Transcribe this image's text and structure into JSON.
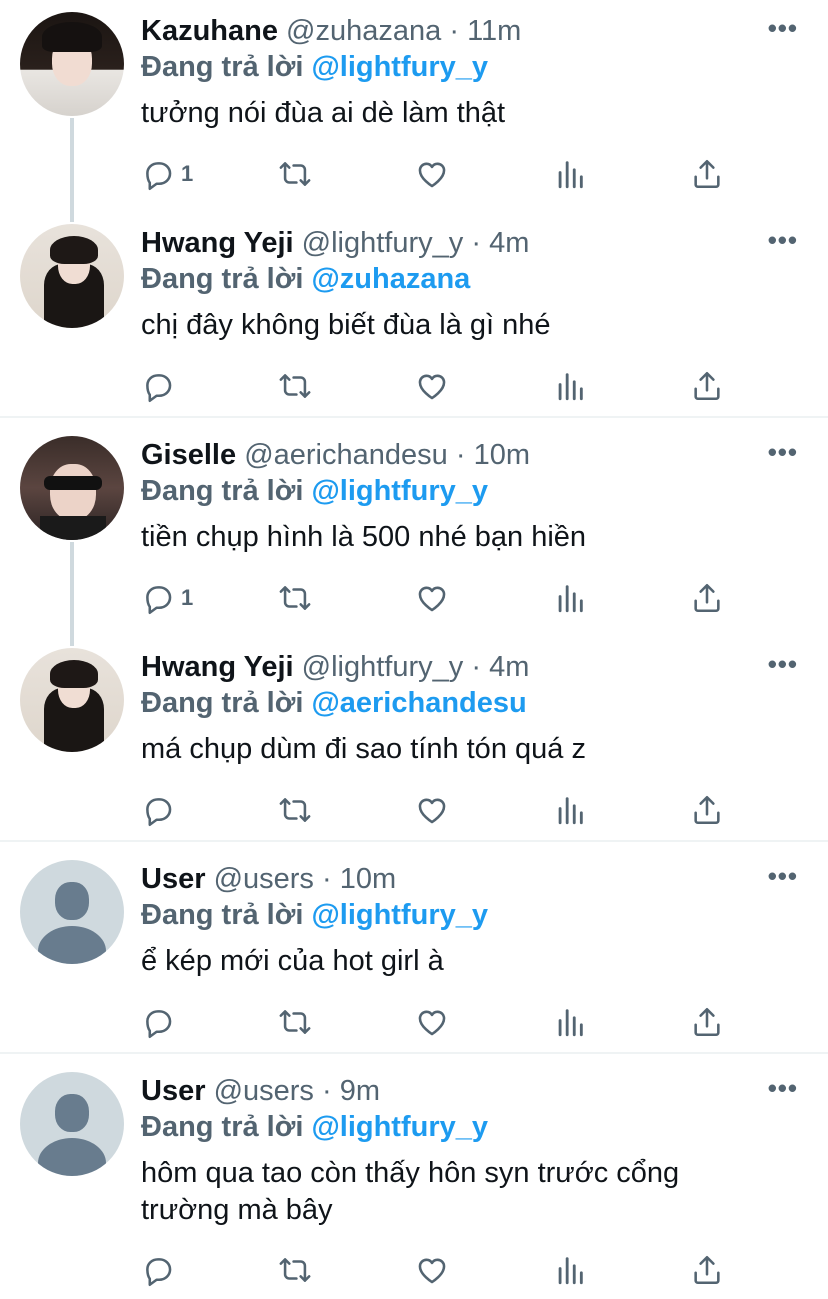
{
  "reply_prefix": "Đang trả lời",
  "more_glyph": "•••",
  "separator": "·",
  "icons": [
    "reply-icon",
    "retweet-icon",
    "like-icon",
    "analytics-icon",
    "share-icon",
    "more-icon"
  ],
  "colors": {
    "mention": "#1d9bf0",
    "muted": "#536471",
    "text": "#0f1419",
    "thread_line": "#cfd9de"
  },
  "tweets": [
    {
      "name": "Kazuhane",
      "handle": "@zuhazana",
      "time": "11m",
      "replying_to": "@lightfury_y",
      "text": "tưởng nói đùa ai dè làm thật",
      "reply_count": "1"
    },
    {
      "name": "Hwang Yeji",
      "handle": "@lightfury_y",
      "time": "4m",
      "replying_to": "@zuhazana",
      "text": "chị đây không biết đùa là gì nhé",
      "reply_count": ""
    },
    {
      "name": "Giselle",
      "handle": "@aerichandesu",
      "time": "10m",
      "replying_to": "@lightfury_y",
      "text": "tiền chụp hình là 500 nhé bạn hiền",
      "reply_count": "1"
    },
    {
      "name": "Hwang Yeji",
      "handle": "@lightfury_y",
      "time": "4m",
      "replying_to": "@aerichandesu",
      "text": "má chụp dùm đi sao tính tón quá z",
      "reply_count": ""
    },
    {
      "name": "User",
      "handle": "@users",
      "time": "10m",
      "replying_to": "@lightfury_y",
      "text": "ể kép mới của hot girl à",
      "reply_count": ""
    },
    {
      "name": "User",
      "handle": "@users",
      "time": "9m",
      "replying_to": "@lightfury_y",
      "text": "hôm qua tao còn thấy hôn syn trước cổng trường mà bây",
      "reply_count": ""
    }
  ]
}
